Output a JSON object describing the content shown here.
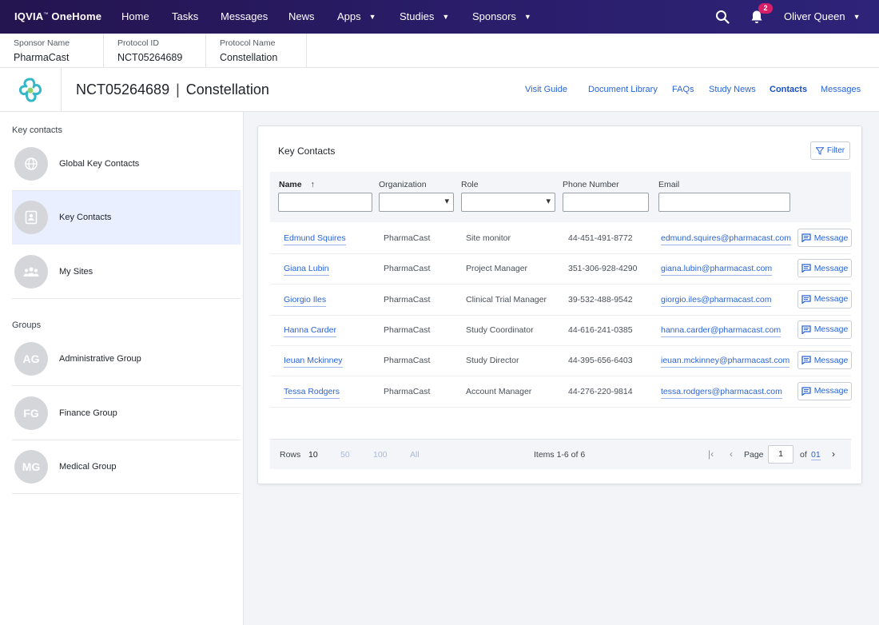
{
  "nav": {
    "brand": "IQVIA",
    "brand_tm": "™",
    "brand_product": "OneHome",
    "items": [
      {
        "label": "Home",
        "dropdown": false
      },
      {
        "label": "Tasks",
        "dropdown": false
      },
      {
        "label": "Messages",
        "dropdown": false
      },
      {
        "label": "News",
        "dropdown": false
      },
      {
        "label": "Apps",
        "dropdown": true
      },
      {
        "label": "Studies",
        "dropdown": true
      },
      {
        "label": "Sponsors",
        "dropdown": true
      }
    ],
    "notification_count": "2",
    "user_name": "Oliver Queen"
  },
  "infobar": {
    "sponsor_label": "Sponsor Name",
    "sponsor_value": "PharmaCast",
    "protocol_id_label": "Protocol ID",
    "protocol_id_value": "NCT05264689",
    "protocol_name_label": "Protocol Name",
    "protocol_name_value": "Constellation"
  },
  "study": {
    "id": "NCT05264689",
    "separator": "|",
    "name": "Constellation",
    "tabs": [
      "Visit Guide",
      "Document Library",
      "FAQs",
      "Study News",
      "Contacts",
      "Messages"
    ],
    "active_tab": "Contacts"
  },
  "sidebar": {
    "key_contacts_label": "Key contacts",
    "key_items": [
      {
        "label": "Global Key Contacts",
        "icon": "globe-icon"
      },
      {
        "label": "Key Contacts",
        "icon": "contact-card-icon"
      },
      {
        "label": "My Sites",
        "icon": "people-icon"
      }
    ],
    "groups_label": "Groups",
    "groups": [
      {
        "initials": "AG",
        "label": "Administrative Group"
      },
      {
        "initials": "FG",
        "label": "Finance Group"
      },
      {
        "initials": "MG",
        "label": "Medical Group"
      }
    ]
  },
  "table": {
    "title": "Key Contacts",
    "filter_label": "Filter",
    "columns": [
      "Name",
      "Organization",
      "Role",
      "Phone Number",
      "Email"
    ],
    "sort_indicator": "↑",
    "message_label": "Message",
    "rows": [
      {
        "name": "Edmund Squires",
        "org": "PharmaCast",
        "role": "Site monitor",
        "phone": "44-451-491-8772",
        "email": "edmund.squires@pharmacast.com"
      },
      {
        "name": "Giana Lubin",
        "org": "PharmaCast",
        "role": "Project Manager",
        "phone": "351-306-928-4290",
        "email": "giana.lubin@pharmacast.com"
      },
      {
        "name": "Giorgio Iles",
        "org": "PharmaCast",
        "role": "Clinical Trial Manager",
        "phone": "39-532-488-9542",
        "email": "giorgio.iles@pharmacast.com"
      },
      {
        "name": "Hanna Carder",
        "org": "PharmaCast",
        "role": "Study Coordinator",
        "phone": "44-616-241-0385",
        "email": "hanna.carder@pharmacast.com"
      },
      {
        "name": "Ieuan Mckinney",
        "org": "PharmaCast",
        "role": "Study Director",
        "phone": "44-395-656-6403",
        "email": "ieuan.mckinney@pharmacast.com"
      },
      {
        "name": "Tessa Rodgers",
        "org": "PharmaCast",
        "role": "Account Manager",
        "phone": "44-276-220-9814",
        "email": "tessa.rodgers@pharmacast.com"
      }
    ]
  },
  "pager": {
    "rows_label": "Rows",
    "rows_options": [
      "10",
      "50",
      "100",
      "All"
    ],
    "rows_selected": "10",
    "items_text": "Items 1-6 of 6",
    "page_label": "Page",
    "page_value": "1",
    "of_label": "of",
    "total_pages": "01"
  }
}
